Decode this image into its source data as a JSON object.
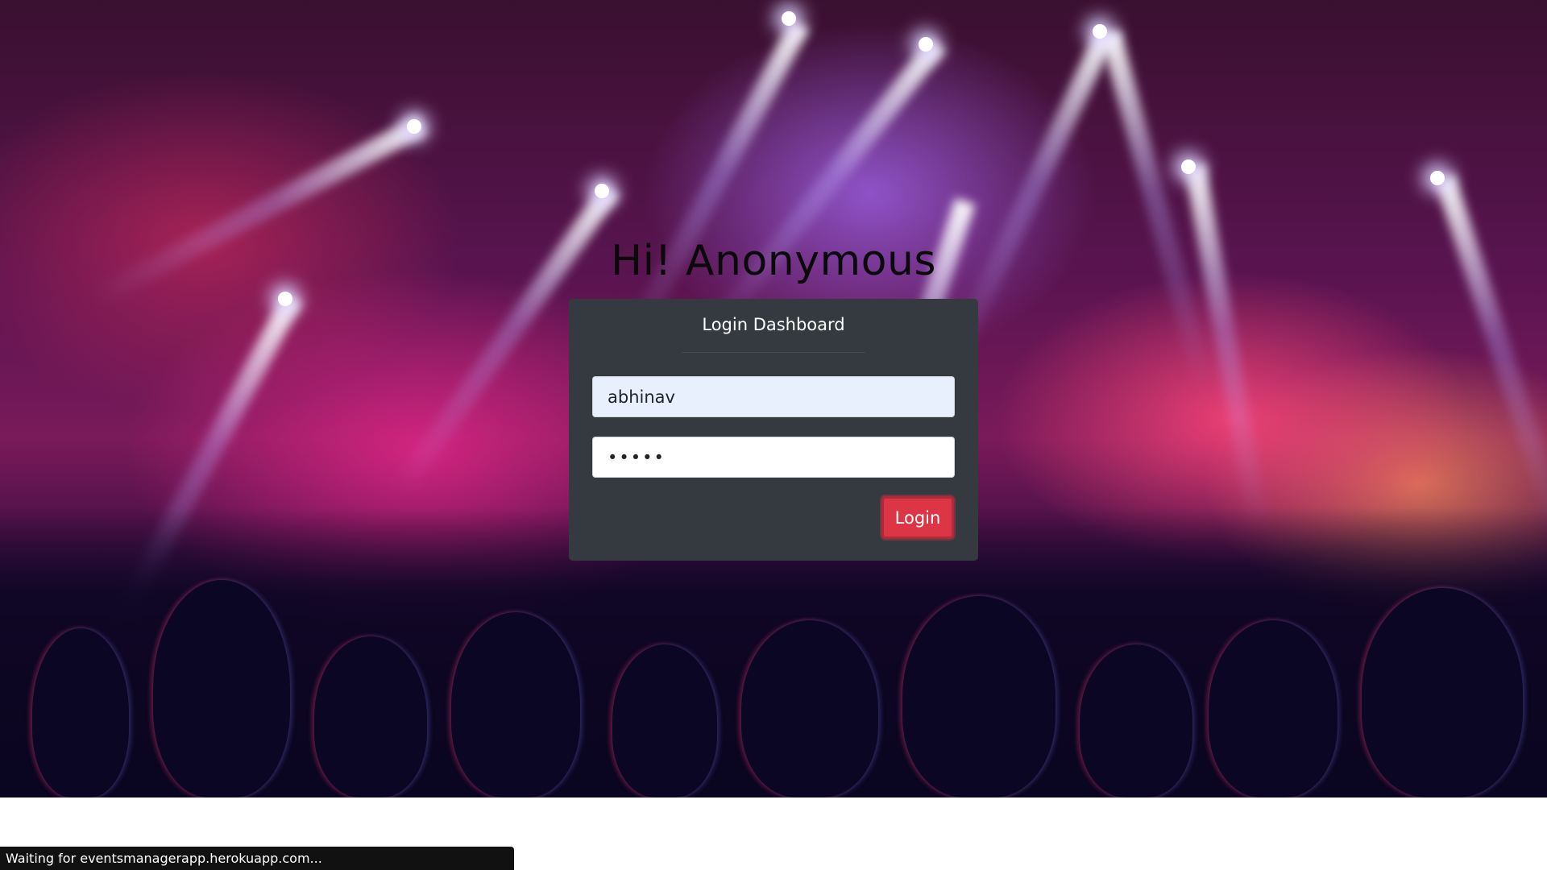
{
  "greeting": "Hi! Anonymous",
  "login_card": {
    "title": "Login Dashboard",
    "username_value": "abhinav",
    "password_value": "abcde",
    "login_label": "Login"
  },
  "status_bar": {
    "text": "Waiting for eventsmanagerapp.herokuapp.com..."
  },
  "colors": {
    "card_bg": "#343a40",
    "login_button": "#dc3545",
    "autofill_field": "#e8f0fe"
  }
}
